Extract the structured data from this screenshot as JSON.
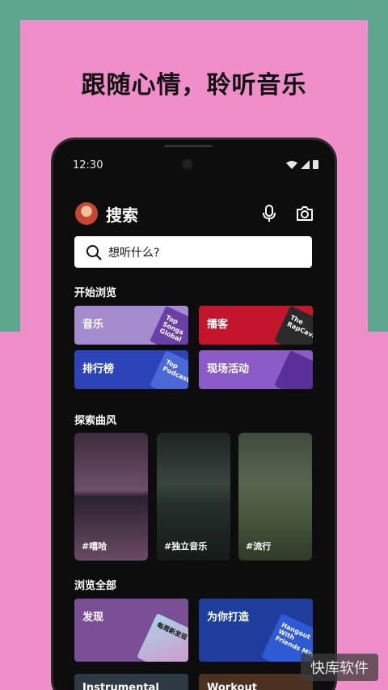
{
  "headline": {
    "part1": "跟随",
    "part2": "心情",
    "part3": "，聆听音乐"
  },
  "status": {
    "time": "12:30"
  },
  "header": {
    "title": "搜索"
  },
  "search": {
    "placeholder": "想听什么?"
  },
  "browse": {
    "title": "开始浏览",
    "tiles": [
      {
        "label": "音乐",
        "art_text": "Top Songs Global",
        "color": "#a48ccf"
      },
      {
        "label": "播客",
        "art_text": "The RapCaviar",
        "color": "#c3162c"
      },
      {
        "label": "排行榜",
        "art_text": "Top Podcasts",
        "color": "#2d44b8"
      },
      {
        "label": "现场活动",
        "art_text": "",
        "color": "#8a5bc9"
      }
    ]
  },
  "genres": {
    "title": "探索曲风",
    "cards": [
      {
        "label": "#嘻哈"
      },
      {
        "label": "#独立音乐"
      },
      {
        "label": "#流行"
      }
    ]
  },
  "all": {
    "title": "浏览全部",
    "tiles": [
      {
        "label": "发现",
        "art_text": "每周新发现",
        "color": "#7b4f95"
      },
      {
        "label": "为你打造",
        "art_text": "Hangout With Friends Mix",
        "color": "#1f3d9c"
      }
    ],
    "partial": [
      {
        "label": "Instrumental"
      },
      {
        "label": "Workout"
      }
    ]
  },
  "watermark": {
    "text": "快库软件"
  }
}
